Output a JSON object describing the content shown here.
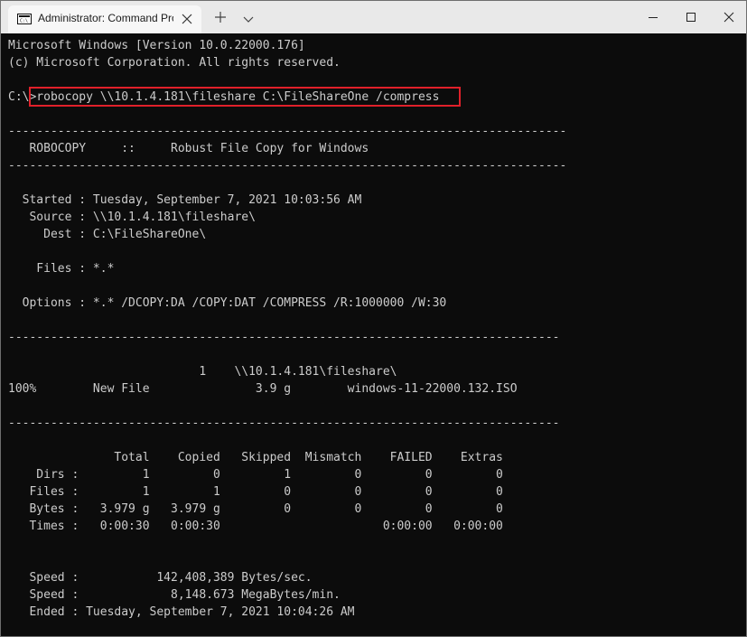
{
  "tab": {
    "title": "Administrator: Command Promp"
  },
  "console": {
    "lines": [
      "Microsoft Windows [Version 10.0.22000.176]",
      "(c) Microsoft Corporation. All rights reserved.",
      "",
      "C:\\>robocopy \\\\10.1.4.181\\fileshare C:\\FileShareOne /compress",
      "",
      "-------------------------------------------------------------------------------",
      "   ROBOCOPY     ::     Robust File Copy for Windows",
      "-------------------------------------------------------------------------------",
      "",
      "  Started : Tuesday, September 7, 2021 10:03:56 AM",
      "   Source : \\\\10.1.4.181\\fileshare\\",
      "     Dest : C:\\FileShareOne\\",
      "",
      "    Files : *.*",
      "",
      "  Options : *.* /DCOPY:DA /COPY:DAT /COMPRESS /R:1000000 /W:30",
      "",
      "------------------------------------------------------------------------------",
      "",
      "                           1    \\\\10.1.4.181\\fileshare\\",
      "100%        New File               3.9 g        windows-11-22000.132.ISO",
      "",
      "------------------------------------------------------------------------------",
      "",
      "               Total    Copied   Skipped  Mismatch    FAILED    Extras",
      "    Dirs :         1         0         1         0         0         0",
      "   Files :         1         1         0         0         0         0",
      "   Bytes :   3.979 g   3.979 g         0         0         0         0",
      "   Times :   0:00:30   0:00:30                       0:00:00   0:00:00",
      "",
      "",
      "   Speed :           142,408,389 Bytes/sec.",
      "   Speed :             8,148.673 MegaBytes/min.",
      "   Ended : Tuesday, September 7, 2021 10:04:26 AM"
    ]
  },
  "colors": {
    "terminal_bg": "#0c0c0c",
    "terminal_text": "#cccccc",
    "titlebar_bg": "#e9e9e9",
    "highlight_border": "#e0202a"
  },
  "icons": {
    "tab": "cmd-icon",
    "close_tab": "close-icon",
    "new_tab": "plus-icon",
    "dropdown": "chevron-down-icon",
    "minimize": "minimize-icon",
    "maximize": "maximize-icon",
    "close_window": "close-icon"
  }
}
